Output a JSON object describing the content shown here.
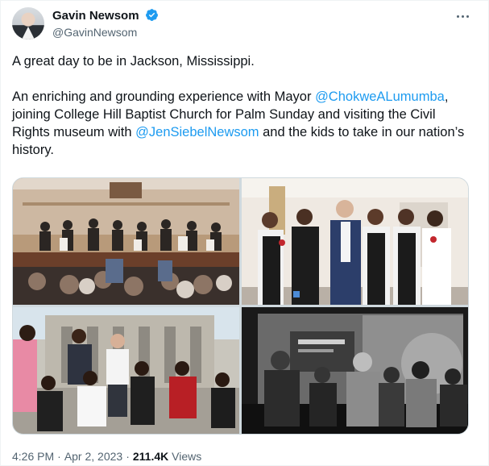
{
  "author": {
    "display_name": "Gavin Newsom",
    "handle": "@GavinNewsom",
    "verified": true,
    "verified_color": "#1d9bf0"
  },
  "more_icon": "more-horizontal-icon",
  "tweet": {
    "line1": "A great day to be in Jackson, Mississippi.",
    "para2_a": "An enriching and grounding experience with Mayor ",
    "mention1": "@ChokweALumumba",
    "para2_b": ", joining College Hill Baptist Church for Palm Sunday and visiting the Civil Rights museum with ",
    "mention2": "@JenSiebelNewsom",
    "para2_c": " and the kids to take in our nation’s history."
  },
  "meta": {
    "time": "4:26 PM",
    "date": "Apr 2, 2023",
    "separator": "·",
    "views_count": "211.4K",
    "views_label": "Views"
  },
  "colors": {
    "link": "#1d9bf0",
    "text": "#0f1419",
    "secondary": "#536471"
  }
}
